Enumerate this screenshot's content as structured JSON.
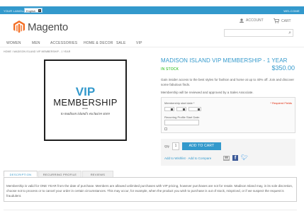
{
  "header": {
    "language_label": "YOUR LANGUAGE:",
    "language_selected": "English",
    "welcome": "WELCOME",
    "brand": "Magento",
    "account_label": "ACCOUNT",
    "cart_label": "CART",
    "search_placeholder": ""
  },
  "nav": {
    "items": [
      {
        "label": "WOMEN"
      },
      {
        "label": "MEN"
      },
      {
        "label": "ACCESSORIES"
      },
      {
        "label": "HOME & DECOR"
      },
      {
        "label": "SALE"
      },
      {
        "label": "VIP"
      }
    ]
  },
  "breadcrumb": "HOME / MADISON ISLAND VIP MEMBERSHIP - 1 YEAR",
  "product_image": {
    "vip": "VIP",
    "membership": "MEMBERSHIP",
    "dots": "•••",
    "subtitle": "to madison island's exclusive store"
  },
  "product": {
    "name": "MADISON ISLAND VIP MEMBERSHIP - 1 YEAR",
    "stock": "IN STOCK",
    "price": "$350.00",
    "description": "Gain insider access to the best styles for fashion and home at up to 40% off. Join and discover some fabulous finds.",
    "approval_note": "Membership will be reviewed and approved by a Sales Associate.",
    "options": {
      "start_date_label": "Membership start date *",
      "required_note": "* Required Fields",
      "recurring_label": "Recurring Profile Start Date:"
    },
    "qty_label": "Qty",
    "qty_value": "1",
    "add_to_cart": "ADD TO CART",
    "add_to_wishlist": "Add to Wishlist",
    "separator": " · ",
    "add_to_compare": "Add to Compare"
  },
  "tabs": {
    "items": [
      {
        "label": "DESCRIPTION"
      },
      {
        "label": "RECURRING PROFILE"
      },
      {
        "label": "REVIEWS"
      }
    ],
    "content": "Membership is valid for ONE YEAR from the date of purchase. Members are allowed unlimited purchases with VIP pricing, however purchases are not for resale. Madison Island may, in its sole discretion, choose not to process or to cancel your order in certain circumstances. This may occur, for example, when the product you wish to purchase is out of stock, mispriced, or if we suspect the request is fraudulent."
  },
  "colors": {
    "accent": "#3399cc",
    "in_stock": "#11b400",
    "required": "#df280a",
    "logo": "#f46f25"
  }
}
